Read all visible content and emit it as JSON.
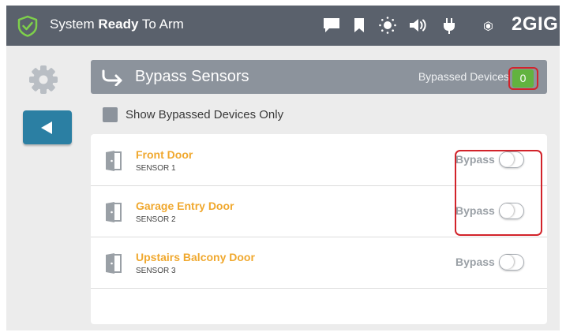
{
  "status": {
    "prefix": "System",
    "bold": "Ready",
    "suffix": "To Arm"
  },
  "topbar_icons": [
    "chat-icon",
    "bookmark-icon",
    "brightness-icon",
    "volume-icon",
    "power-plug-icon"
  ],
  "brand": {
    "text": "2GIG"
  },
  "header": {
    "title": "Bypass Sensors",
    "bypassed_label": "Bypassed Devices",
    "bypassed_count": "0"
  },
  "filter": {
    "label": "Show Bypassed Devices Only",
    "checked": false
  },
  "sensors": [
    {
      "name": "Front Door",
      "sub": "SENSOR 1",
      "bypass_label": "Bypass",
      "bypassed": false
    },
    {
      "name": "Garage Entry Door",
      "sub": "SENSOR 2",
      "bypass_label": "Bypass",
      "bypassed": false
    },
    {
      "name": "Upstairs Balcony Door",
      "sub": "SENSOR 3",
      "bypass_label": "Bypass",
      "bypassed": false
    }
  ],
  "colors": {
    "topbar": "#5a616c",
    "accent_orange": "#f0a82e",
    "back_button": "#2b7fa3",
    "badge_green": "#62b33f",
    "highlight_red": "#d2232a"
  }
}
